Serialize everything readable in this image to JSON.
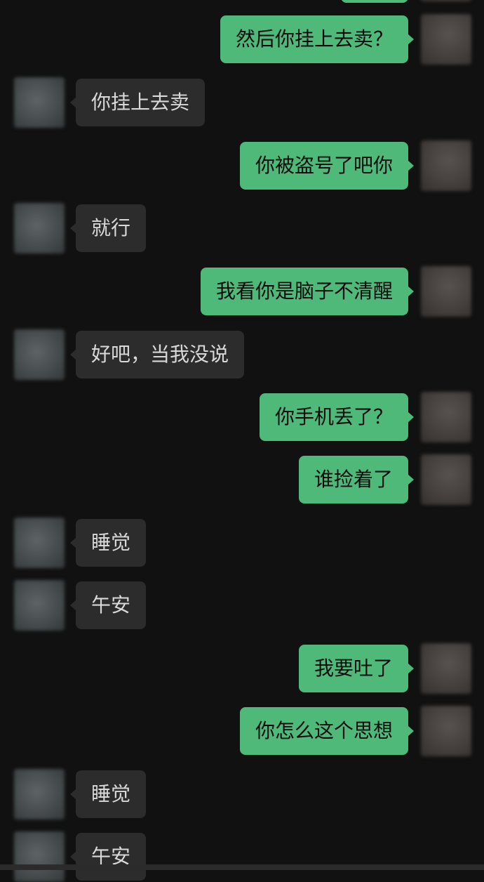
{
  "app": {
    "background_color": "#111111",
    "incoming_bubble_color": "#2c2c2c",
    "outgoing_bubble_color": "#4fb97a"
  },
  "messages": [
    {
      "side": "out",
      "text": "然后你挂上去卖？"
    },
    {
      "side": "in",
      "text": "你挂上去卖"
    },
    {
      "side": "out",
      "text": "你被盗号了吧你"
    },
    {
      "side": "in",
      "text": "就行"
    },
    {
      "side": "out",
      "text": "我看你是脑子不清醒"
    },
    {
      "side": "in",
      "text": "好吧，当我没说"
    },
    {
      "side": "out",
      "text": "你手机丢了？"
    },
    {
      "side": "out",
      "text": "谁捡着了"
    },
    {
      "side": "in",
      "text": "睡觉"
    },
    {
      "side": "in",
      "text": "午安"
    },
    {
      "side": "out",
      "text": "我要吐了"
    },
    {
      "side": "out",
      "text": "你怎么这个思想"
    },
    {
      "side": "in",
      "text": "睡觉"
    },
    {
      "side": "in",
      "text": "午安"
    }
  ]
}
